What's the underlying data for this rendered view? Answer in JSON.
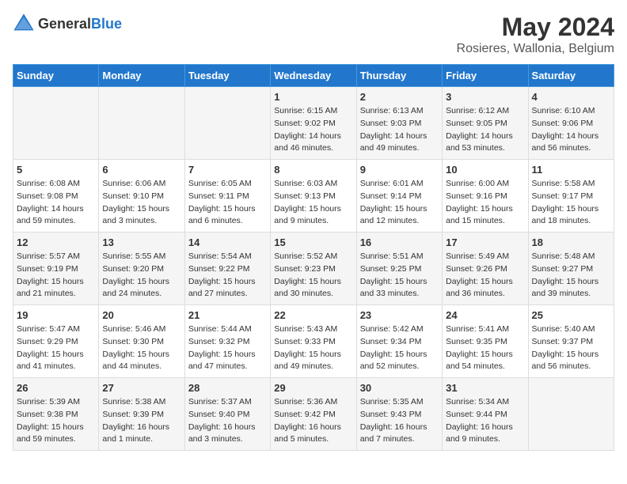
{
  "header": {
    "logo_general": "General",
    "logo_blue": "Blue",
    "title": "May 2024",
    "subtitle": "Rosieres, Wallonia, Belgium"
  },
  "days_of_week": [
    "Sunday",
    "Monday",
    "Tuesday",
    "Wednesday",
    "Thursday",
    "Friday",
    "Saturday"
  ],
  "weeks": [
    [
      {
        "day": "",
        "info": ""
      },
      {
        "day": "",
        "info": ""
      },
      {
        "day": "",
        "info": ""
      },
      {
        "day": "1",
        "info": "Sunrise: 6:15 AM\nSunset: 9:02 PM\nDaylight: 14 hours\nand 46 minutes."
      },
      {
        "day": "2",
        "info": "Sunrise: 6:13 AM\nSunset: 9:03 PM\nDaylight: 14 hours\nand 49 minutes."
      },
      {
        "day": "3",
        "info": "Sunrise: 6:12 AM\nSunset: 9:05 PM\nDaylight: 14 hours\nand 53 minutes."
      },
      {
        "day": "4",
        "info": "Sunrise: 6:10 AM\nSunset: 9:06 PM\nDaylight: 14 hours\nand 56 minutes."
      }
    ],
    [
      {
        "day": "5",
        "info": "Sunrise: 6:08 AM\nSunset: 9:08 PM\nDaylight: 14 hours\nand 59 minutes."
      },
      {
        "day": "6",
        "info": "Sunrise: 6:06 AM\nSunset: 9:10 PM\nDaylight: 15 hours\nand 3 minutes."
      },
      {
        "day": "7",
        "info": "Sunrise: 6:05 AM\nSunset: 9:11 PM\nDaylight: 15 hours\nand 6 minutes."
      },
      {
        "day": "8",
        "info": "Sunrise: 6:03 AM\nSunset: 9:13 PM\nDaylight: 15 hours\nand 9 minutes."
      },
      {
        "day": "9",
        "info": "Sunrise: 6:01 AM\nSunset: 9:14 PM\nDaylight: 15 hours\nand 12 minutes."
      },
      {
        "day": "10",
        "info": "Sunrise: 6:00 AM\nSunset: 9:16 PM\nDaylight: 15 hours\nand 15 minutes."
      },
      {
        "day": "11",
        "info": "Sunrise: 5:58 AM\nSunset: 9:17 PM\nDaylight: 15 hours\nand 18 minutes."
      }
    ],
    [
      {
        "day": "12",
        "info": "Sunrise: 5:57 AM\nSunset: 9:19 PM\nDaylight: 15 hours\nand 21 minutes."
      },
      {
        "day": "13",
        "info": "Sunrise: 5:55 AM\nSunset: 9:20 PM\nDaylight: 15 hours\nand 24 minutes."
      },
      {
        "day": "14",
        "info": "Sunrise: 5:54 AM\nSunset: 9:22 PM\nDaylight: 15 hours\nand 27 minutes."
      },
      {
        "day": "15",
        "info": "Sunrise: 5:52 AM\nSunset: 9:23 PM\nDaylight: 15 hours\nand 30 minutes."
      },
      {
        "day": "16",
        "info": "Sunrise: 5:51 AM\nSunset: 9:25 PM\nDaylight: 15 hours\nand 33 minutes."
      },
      {
        "day": "17",
        "info": "Sunrise: 5:49 AM\nSunset: 9:26 PM\nDaylight: 15 hours\nand 36 minutes."
      },
      {
        "day": "18",
        "info": "Sunrise: 5:48 AM\nSunset: 9:27 PM\nDaylight: 15 hours\nand 39 minutes."
      }
    ],
    [
      {
        "day": "19",
        "info": "Sunrise: 5:47 AM\nSunset: 9:29 PM\nDaylight: 15 hours\nand 41 minutes."
      },
      {
        "day": "20",
        "info": "Sunrise: 5:46 AM\nSunset: 9:30 PM\nDaylight: 15 hours\nand 44 minutes."
      },
      {
        "day": "21",
        "info": "Sunrise: 5:44 AM\nSunset: 9:32 PM\nDaylight: 15 hours\nand 47 minutes."
      },
      {
        "day": "22",
        "info": "Sunrise: 5:43 AM\nSunset: 9:33 PM\nDaylight: 15 hours\nand 49 minutes."
      },
      {
        "day": "23",
        "info": "Sunrise: 5:42 AM\nSunset: 9:34 PM\nDaylight: 15 hours\nand 52 minutes."
      },
      {
        "day": "24",
        "info": "Sunrise: 5:41 AM\nSunset: 9:35 PM\nDaylight: 15 hours\nand 54 minutes."
      },
      {
        "day": "25",
        "info": "Sunrise: 5:40 AM\nSunset: 9:37 PM\nDaylight: 15 hours\nand 56 minutes."
      }
    ],
    [
      {
        "day": "26",
        "info": "Sunrise: 5:39 AM\nSunset: 9:38 PM\nDaylight: 15 hours\nand 59 minutes."
      },
      {
        "day": "27",
        "info": "Sunrise: 5:38 AM\nSunset: 9:39 PM\nDaylight: 16 hours\nand 1 minute."
      },
      {
        "day": "28",
        "info": "Sunrise: 5:37 AM\nSunset: 9:40 PM\nDaylight: 16 hours\nand 3 minutes."
      },
      {
        "day": "29",
        "info": "Sunrise: 5:36 AM\nSunset: 9:42 PM\nDaylight: 16 hours\nand 5 minutes."
      },
      {
        "day": "30",
        "info": "Sunrise: 5:35 AM\nSunset: 9:43 PM\nDaylight: 16 hours\nand 7 minutes."
      },
      {
        "day": "31",
        "info": "Sunrise: 5:34 AM\nSunset: 9:44 PM\nDaylight: 16 hours\nand 9 minutes."
      },
      {
        "day": "",
        "info": ""
      }
    ]
  ]
}
